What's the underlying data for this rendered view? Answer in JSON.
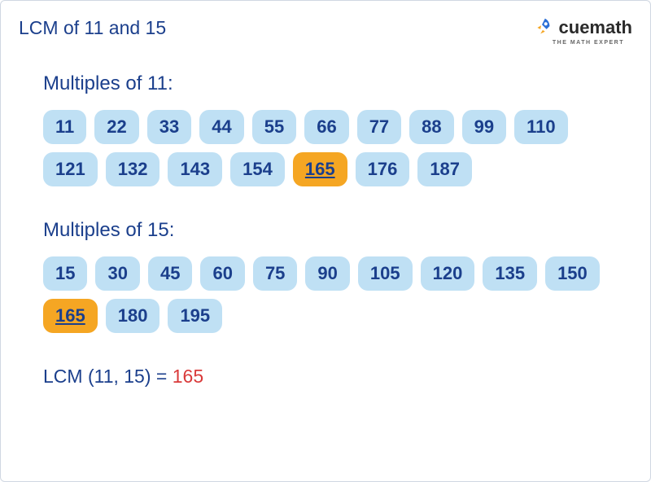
{
  "title": "LCM of 11 and 15",
  "brand": {
    "name": "cuemath",
    "tagline": "THE MATH EXPERT"
  },
  "sections": [
    {
      "label": "Multiples of 11:",
      "multiples": [
        {
          "v": 11
        },
        {
          "v": 22
        },
        {
          "v": 33
        },
        {
          "v": 44
        },
        {
          "v": 55
        },
        {
          "v": 66
        },
        {
          "v": 77
        },
        {
          "v": 88
        },
        {
          "v": 99
        },
        {
          "v": 110
        },
        {
          "v": 121
        },
        {
          "v": 132
        },
        {
          "v": 143
        },
        {
          "v": 154
        },
        {
          "v": 165,
          "hl": true
        },
        {
          "v": 176
        },
        {
          "v": 187
        }
      ]
    },
    {
      "label": "Multiples of 15:",
      "multiples": [
        {
          "v": 15
        },
        {
          "v": 30
        },
        {
          "v": 45
        },
        {
          "v": 60
        },
        {
          "v": 75
        },
        {
          "v": 90
        },
        {
          "v": 105
        },
        {
          "v": 120
        },
        {
          "v": 135
        },
        {
          "v": 150
        },
        {
          "v": 165,
          "hl": true
        },
        {
          "v": 180
        },
        {
          "v": 195
        }
      ]
    }
  ],
  "result": {
    "prefix": "LCM (11, 15) = ",
    "answer": "165"
  },
  "chart_data": {
    "type": "table",
    "title": "LCM of 11 and 15 by listing multiples",
    "series": [
      {
        "name": "Multiples of 11",
        "values": [
          11,
          22,
          33,
          44,
          55,
          66,
          77,
          88,
          99,
          110,
          121,
          132,
          143,
          154,
          165,
          176,
          187
        ]
      },
      {
        "name": "Multiples of 15",
        "values": [
          15,
          30,
          45,
          60,
          75,
          90,
          105,
          120,
          135,
          150,
          165,
          180,
          195
        ]
      }
    ],
    "highlight_value": 165,
    "lcm": 165
  }
}
